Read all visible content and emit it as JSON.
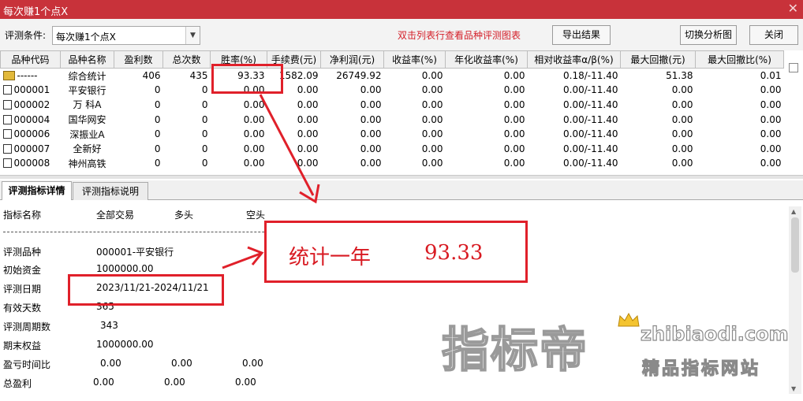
{
  "window": {
    "title": "每次赚1个点X",
    "close_glyph": "✕"
  },
  "toolbar": {
    "criteria_label": "评测条件:",
    "criteria_value": "每次赚1个点X",
    "hint": "双击列表行查看品种评测图表",
    "export_label": "导出结果",
    "switch_label": "切换分析图",
    "close_label": "关闭"
  },
  "grid": {
    "headers": [
      "品种代码",
      "品种名称",
      "盈利数",
      "总次数",
      "胜率(%)",
      "手续费(元)",
      "净利润(元)",
      "收益率(%)",
      "年化收益率(%)",
      "相对收益率α/β(%)",
      "最大回撤(元)",
      "最大回撤比(%)"
    ],
    "rows": [
      [
        "------",
        "综合统计",
        "406",
        "435",
        "93.33",
        "1582.09",
        "26749.92",
        "0.00",
        "0.00",
        "0.18/-11.40",
        "51.38",
        "0.01"
      ],
      [
        "000001",
        "平安银行",
        "0",
        "0",
        "0.00",
        "0.00",
        "0.00",
        "0.00",
        "0.00",
        "0.00/-11.40",
        "0.00",
        "0.00"
      ],
      [
        "000002",
        "万 科A",
        "0",
        "0",
        "0.00",
        "0.00",
        "0.00",
        "0.00",
        "0.00",
        "0.00/-11.40",
        "0.00",
        "0.00"
      ],
      [
        "000004",
        "国华网安",
        "0",
        "0",
        "0.00",
        "0.00",
        "0.00",
        "0.00",
        "0.00",
        "0.00/-11.40",
        "0.00",
        "0.00"
      ],
      [
        "000006",
        "深振业A",
        "0",
        "0",
        "0.00",
        "0.00",
        "0.00",
        "0.00",
        "0.00",
        "0.00/-11.40",
        "0.00",
        "0.00"
      ],
      [
        "000007",
        "全新好",
        "0",
        "0",
        "0.00",
        "0.00",
        "0.00",
        "0.00",
        "0.00",
        "0.00/-11.40",
        "0.00",
        "0.00"
      ],
      [
        "000008",
        "神州高铁",
        "0",
        "0",
        "0.00",
        "0.00",
        "0.00",
        "0.00",
        "0.00",
        "0.00/-11.40",
        "0.00",
        "0.00"
      ]
    ]
  },
  "tabs": [
    {
      "label": "评测指标详情",
      "active": true
    },
    {
      "label": "评测指标说明",
      "active": false
    }
  ],
  "detail": {
    "columns": [
      "指标名称",
      "全部交易",
      "多头",
      "空头"
    ],
    "stock_label": "评测品种",
    "stock_value": "000001-平安银行",
    "capital_label": "初始资金",
    "capital_value": "1000000.00",
    "date_label": "评测日期",
    "date_value": "2023/11/21-2024/11/21",
    "days_label": "有效天数",
    "days_value": "365",
    "periods_label": "评测周期数",
    "periods_value": "343",
    "equity_label": "期末权益",
    "equity_value": "1000000.00",
    "ratio_label": "盈亏时间比",
    "ratio_values": [
      "0.00",
      "0.00",
      "0.00"
    ],
    "profit_label": "总盈利",
    "profit_values": [
      "0.00",
      "0.00",
      "0.00"
    ]
  },
  "annotation": {
    "text": "统计一年",
    "value": "93.33",
    "color": "#e0202a"
  },
  "watermark": {
    "brand": "指标帝",
    "site": "zhibiaodi.com",
    "slogan": "精品指标网站"
  }
}
